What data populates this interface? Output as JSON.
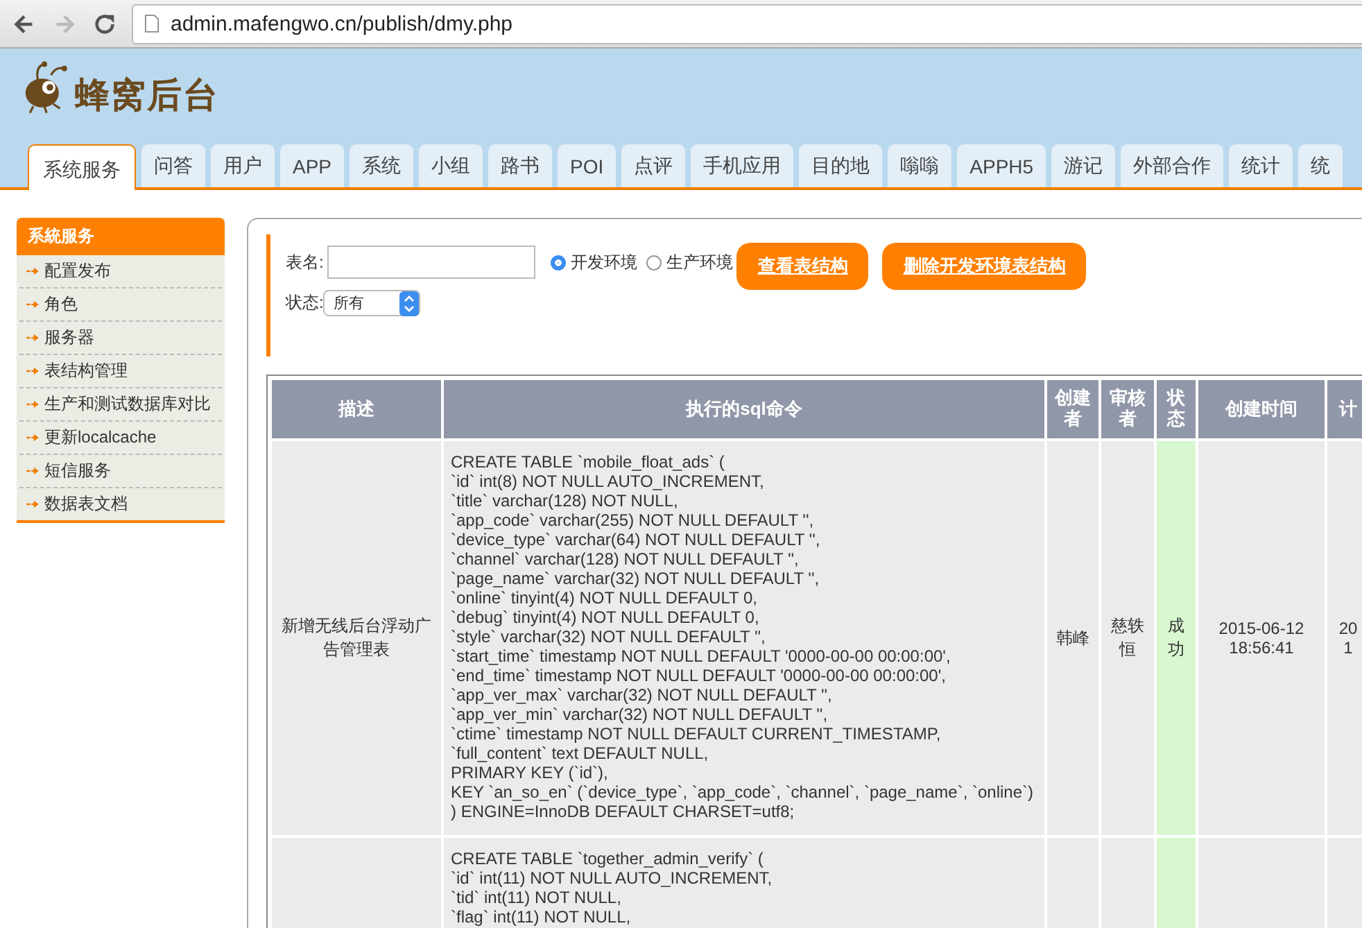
{
  "browser": {
    "url": "admin.mafengwo.cn/publish/dmy.php",
    "forward_disabled": true
  },
  "logo": {
    "text": "蜂窝后台"
  },
  "tabs": [
    {
      "label": "系统服务",
      "selected": true
    },
    {
      "label": "问答",
      "selected": false
    },
    {
      "label": "用户",
      "selected": false
    },
    {
      "label": "APP",
      "selected": false
    },
    {
      "label": "系统",
      "selected": false
    },
    {
      "label": "小组",
      "selected": false
    },
    {
      "label": "路书",
      "selected": false
    },
    {
      "label": "POI",
      "selected": false
    },
    {
      "label": "点评",
      "selected": false
    },
    {
      "label": "手机应用",
      "selected": false
    },
    {
      "label": "目的地",
      "selected": false
    },
    {
      "label": "嗡嗡",
      "selected": false
    },
    {
      "label": "APPH5",
      "selected": false
    },
    {
      "label": "游记",
      "selected": false
    },
    {
      "label": "外部合作",
      "selected": false
    },
    {
      "label": "统计",
      "selected": false
    },
    {
      "label": "统",
      "selected": false
    }
  ],
  "sidebar": {
    "title": "系統服务",
    "items": [
      "配置发布",
      "角色",
      "服务器",
      "表结构管理",
      "生产和测试数据库对比",
      "更新localcache",
      "短信服务",
      "数据表文档"
    ]
  },
  "form": {
    "table_name_label": "表名:",
    "env_options": [
      {
        "label": "开发环境",
        "selected": true
      },
      {
        "label": "生产环境",
        "selected": false
      }
    ],
    "buttons": [
      "查看表结构",
      "删除开发环境表结构"
    ],
    "status_label": "状态:",
    "status_value": "所有"
  },
  "table": {
    "columns": [
      "描述",
      "执行的sql命令",
      "创建者",
      "审核者",
      "状态",
      "创建时间",
      "计"
    ],
    "rows": [
      {
        "description": "新增无线后台浮动广告管理表",
        "sql": [
          "CREATE TABLE `mobile_float_ads` (",
          "`id` int(8) NOT NULL AUTO_INCREMENT,",
          "`title` varchar(128) NOT NULL,",
          "`app_code` varchar(255) NOT NULL DEFAULT '',",
          "`device_type` varchar(64) NOT NULL DEFAULT '',",
          "`channel` varchar(128) NOT NULL DEFAULT '',",
          "`page_name` varchar(32) NOT NULL DEFAULT '',",
          "`online` tinyint(4) NOT NULL DEFAULT 0,",
          "`debug` tinyint(4) NOT NULL DEFAULT 0,",
          "`style` varchar(32) NOT NULL DEFAULT '',",
          "`start_time` timestamp NOT NULL DEFAULT '0000-00-00 00:00:00',",
          "`end_time` timestamp NOT NULL DEFAULT '0000-00-00 00:00:00',",
          "`app_ver_max` varchar(32) NOT NULL DEFAULT '',",
          "`app_ver_min` varchar(32) NOT NULL DEFAULT '',",
          "`ctime` timestamp NOT NULL DEFAULT CURRENT_TIMESTAMP,",
          "`full_content` text DEFAULT NULL,",
          "PRIMARY KEY (`id`),",
          "KEY `an_so_en` (`device_type`, `app_code`, `channel`, `page_name`, `online`)",
          ") ENGINE=InnoDB DEFAULT CHARSET=utf8;"
        ],
        "creator": "韩峰",
        "reviewer": "慈轶恒",
        "status": "成功",
        "created_time": "2015-06-12 18:56:41",
        "column_7": [
          "20",
          "1"
        ]
      },
      {
        "sql": [
          "CREATE TABLE `together_admin_verify` (",
          "`id` int(11) NOT NULL AUTO_INCREMENT,",
          "`tid` int(11) NOT NULL,",
          "`flag` int(11) NOT NULL,"
        ]
      }
    ]
  }
}
